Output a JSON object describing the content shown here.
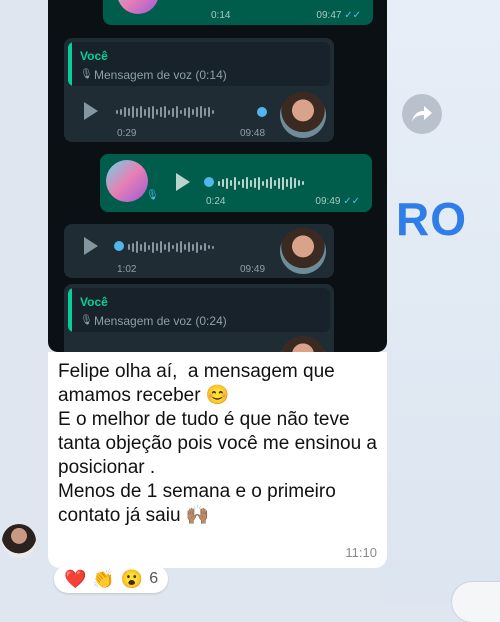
{
  "brand_partial": "RO",
  "messages": [
    {
      "kind": "voice",
      "dir": "out",
      "duration": "0:14",
      "time": "09:47"
    },
    {
      "kind": "voice_reply",
      "dir": "in",
      "quote_sender": "Você",
      "quote_text": "Mensagem de voz (0:14)",
      "duration": "0:29",
      "time": "09:48"
    },
    {
      "kind": "voice",
      "dir": "out",
      "duration": "0:24",
      "time": "09:49"
    },
    {
      "kind": "voice",
      "dir": "in",
      "duration": "1:02",
      "time": "09:49"
    },
    {
      "kind": "voice_reply",
      "dir": "in",
      "quote_sender": "Você",
      "quote_text": "Mensagem de voz (0:24)"
    }
  ],
  "chat_message": {
    "text": "Felipe olha aí,  a mensagem que amamos receber 😊\nE o melhor de tudo é que não teve tanta objeção pois você me ensinou a posicionar .\nMenos de 1 semana e o primeiro contato já saiu 🙌🏽",
    "time": "11:10"
  },
  "reactions": {
    "emojis": [
      "❤️",
      "👏",
      "😮"
    ],
    "count": "6"
  },
  "icons": {
    "share": "forward-arrow-icon",
    "mic": "microphone-icon",
    "play": "play-icon",
    "read": "double-check-icon"
  }
}
